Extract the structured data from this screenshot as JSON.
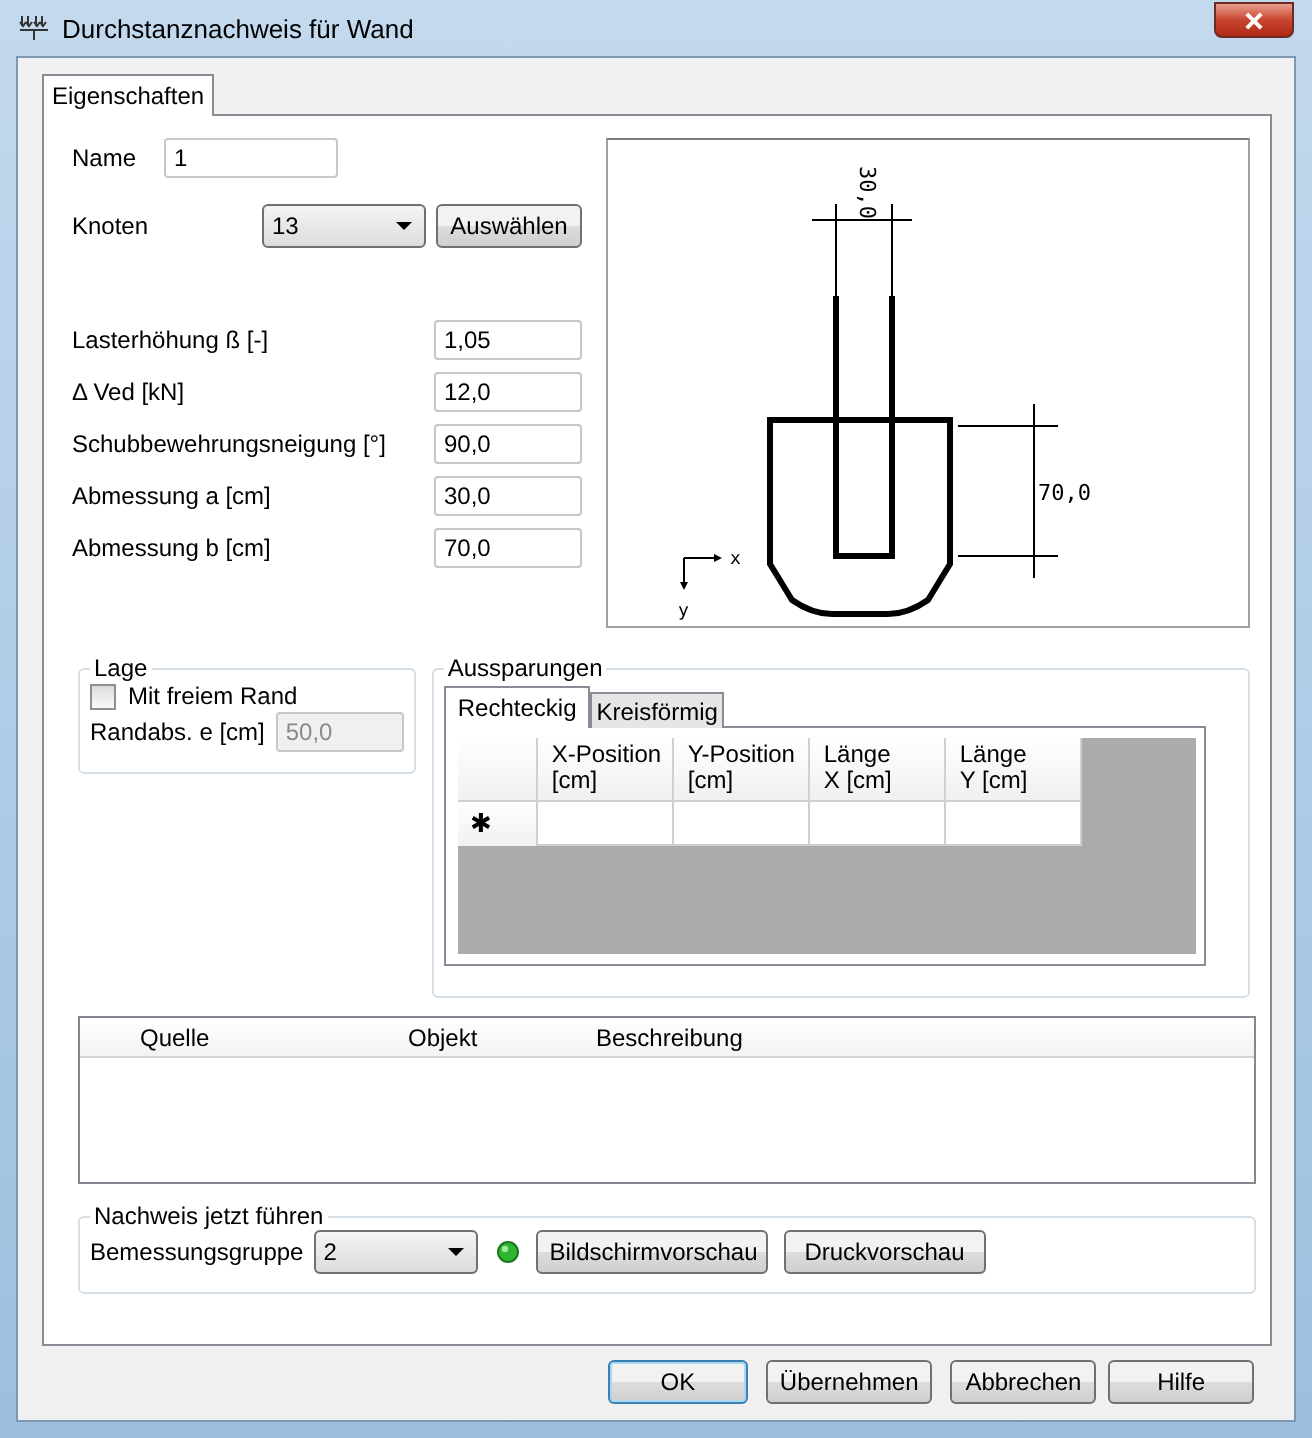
{
  "window": {
    "title": "Durchstanznachweis für Wand"
  },
  "tabs": [
    {
      "label": "Eigenschaften",
      "selected": true
    }
  ],
  "name": {
    "label": "Name",
    "value": "1"
  },
  "knoten": {
    "label": "Knoten",
    "value": "13",
    "button": "Auswählen"
  },
  "fields": [
    {
      "label": "Lasterhöhung ß [-]",
      "value": "1,05"
    },
    {
      "label": "Δ Ved [kN]",
      "value": "12,0"
    },
    {
      "label": "Schubbewehrungsneigung [°]",
      "value": "90,0"
    },
    {
      "label": "Abmessung a [cm]",
      "value": "30,0"
    },
    {
      "label": "Abmessung b [cm]",
      "value": "70,0"
    }
  ],
  "drawing": {
    "dim_a": "30,0",
    "dim_b": "70,0",
    "axis_x": "x",
    "axis_y": "y"
  },
  "lage": {
    "title": "Lage",
    "checkbox": {
      "label": "Mit freiem Rand",
      "checked": false
    },
    "field": {
      "label": "Randabs. e [cm]",
      "value": "50,0",
      "disabled": true
    }
  },
  "aussparungen": {
    "title": "Aussparungen",
    "tabs": [
      {
        "label": "Rechteckig",
        "selected": true
      },
      {
        "label": "Kreisförmig",
        "selected": false
      }
    ],
    "columns": [
      [
        "X-Position",
        "[cm]"
      ],
      [
        "Y-Position",
        "[cm]"
      ],
      [
        "Länge",
        "X [cm]"
      ],
      [
        "Länge",
        "Y [cm]"
      ]
    ],
    "new_row_marker": "✱"
  },
  "messages": {
    "columns": [
      "Quelle",
      "Objekt",
      "Beschreibung"
    ]
  },
  "nachweis": {
    "title": "Nachweis jetzt führen",
    "label": "Bemessungsgruppe",
    "value": "2",
    "buttons": [
      "Bildschirmvorschau",
      "Druckvorschau"
    ]
  },
  "buttons": [
    {
      "label": "OK",
      "default": true
    },
    {
      "label": "Übernehmen",
      "default": false
    },
    {
      "label": "Abbrechen",
      "default": false
    },
    {
      "label": "Hilfe",
      "default": false
    }
  ]
}
